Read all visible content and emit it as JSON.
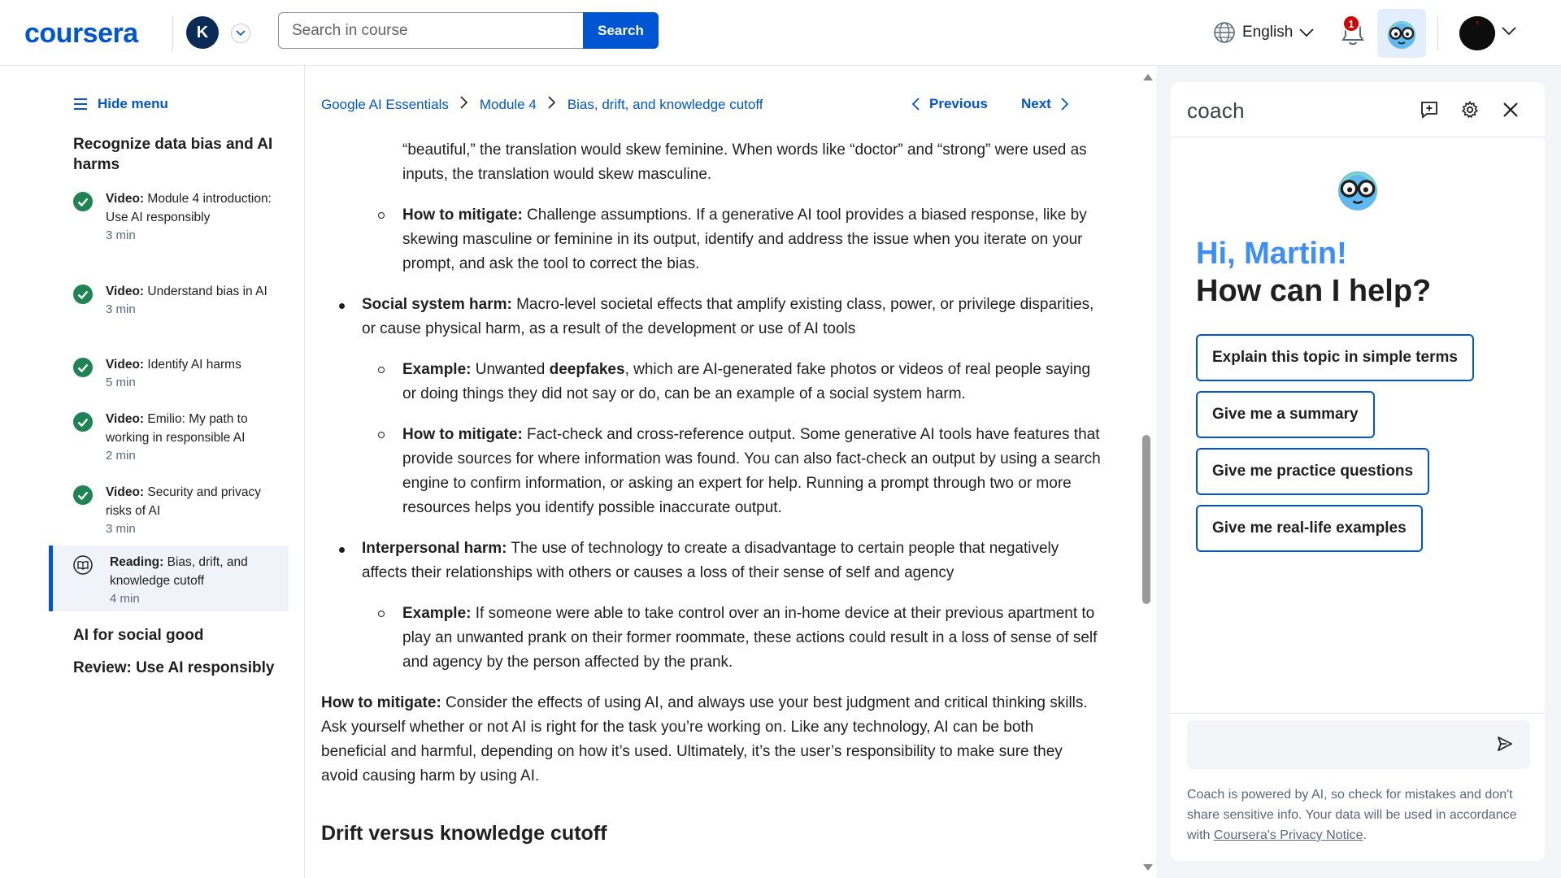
{
  "header": {
    "logo_text": "coursera",
    "account_initial": "K",
    "search": {
      "placeholder": "Search in course",
      "button_label": "Search"
    },
    "language": "English",
    "notification_count": "1"
  },
  "sidebar": {
    "hide_menu_label": "Hide menu",
    "lesson_title": "Recognize data bias and AI harms",
    "items": [
      {
        "type": "Video:",
        "title": "Module 4 introduction: Use AI responsibly",
        "duration": "3 min",
        "status": "completed"
      },
      {
        "type": "Video:",
        "title": "Understand bias in AI",
        "duration": "3 min",
        "status": "completed"
      },
      {
        "type": "Video:",
        "title": "Identify AI harms",
        "duration": "5 min",
        "status": "completed"
      },
      {
        "type": "Video:",
        "title": "Emilio: My path to working in responsible AI",
        "duration": "2 min",
        "status": "completed"
      },
      {
        "type": "Video:",
        "title": "Security and privacy risks of AI",
        "duration": "3 min",
        "status": "completed"
      },
      {
        "type": "Reading:",
        "title": "Bias, drift, and knowledge cutoff",
        "duration": "4 min",
        "status": "current"
      }
    ],
    "sections": [
      "AI for social good",
      "Review: Use AI responsibly"
    ]
  },
  "breadcrumb": {
    "items": [
      "Google AI Essentials",
      "Module 4",
      "Bias, drift, and knowledge cutoff"
    ],
    "prev_label": "Previous",
    "next_label": "Next"
  },
  "content": {
    "p0": "“beautiful,” the translation would skew feminine. When words like “doctor” and “strong” were used as inputs, the translation would skew masculine.",
    "b1_label": "How to mitigate:",
    "b1_text": " Challenge assumptions. If a generative AI tool provides a biased response, like by skewing masculine or feminine in its output, identify and address the issue when you iterate on your prompt, and ask the tool to correct the bias.",
    "b2_label": "Social system harm:",
    "b2_text": " Macro-level societal effects that amplify existing class, power, or privilege disparities, or cause physical harm, as a result of the development or use of AI tools",
    "b3_label": "Example:",
    "b3_pre": " Unwanted ",
    "b3_bold": "deepfakes",
    "b3_post": ", which are AI-generated fake photos or videos of real people saying or doing things they did not say or do, can be an example of a social system harm.",
    "b4_label": "How to mitigate:",
    "b4_text": " Fact-check and cross-reference output. Some generative AI tools have features that provide sources for where information was found. You can also fact-check an output by using a search engine to confirm information, or asking an expert for help. Running a prompt through two or more resources helps you identify possible inaccurate output.",
    "b5_label": "Interpersonal harm:",
    "b5_text": " The use of technology to create a disadvantage to certain people that negatively affects their relationships with others or causes a loss of their sense of self and agency",
    "b6_label": "Example:",
    "b6_text": " If someone were able to take control over an in-home device at their previous apartment to play an unwanted prank on their former roommate, these actions could result in a loss of sense of self and agency by the person affected by the prank.",
    "p1_label": "How to mitigate:",
    "p1_text": " Consider the effects of using AI, and always use your best judgment and critical thinking skills. Ask yourself whether or not AI is right for the task you’re working on. Like any technology, AI can be both beneficial and harmful, depending on how it’s used. Ultimately, it’s the user’s responsibility to make sure they avoid causing harm by using AI.",
    "heading": "Drift versus knowledge cutoff"
  },
  "coach": {
    "title": "coach",
    "greeting": "Hi, Martin!",
    "prompt": "How can I help?",
    "suggestions": [
      "Explain this topic in simple terms",
      "Give me a summary",
      "Give me practice questions",
      "Give me real-life examples"
    ],
    "disclaimer_text": "Coach is powered by AI, so check for mistakes and don't share sensitive info. Your data will be used in accordance with ",
    "disclaimer_link": "Coursera's Privacy Notice",
    "disclaimer_end": "."
  },
  "colors": {
    "brand": "#0056d2",
    "greeting": "#3e8ef7",
    "completed": "#1f8354",
    "badge": "#d30001"
  }
}
